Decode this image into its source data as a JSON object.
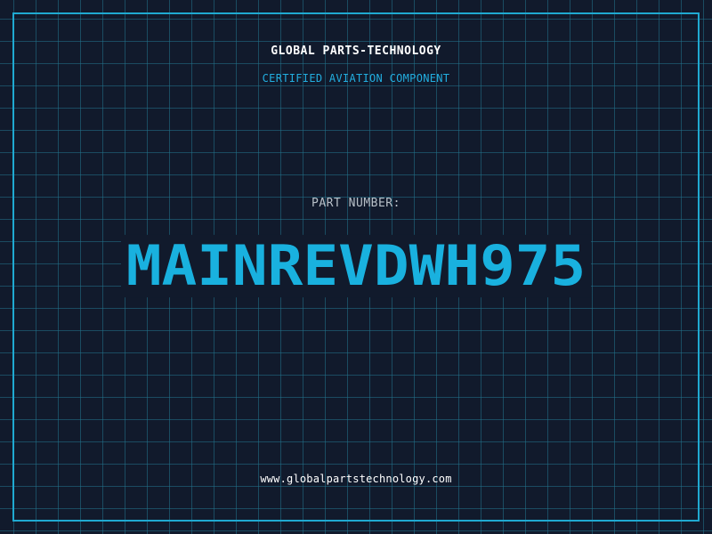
{
  "company": {
    "name": "GLOBAL PARTS-TECHNOLOGY",
    "tagline": "CERTIFIED AVIATION COMPONENT"
  },
  "part": {
    "label": "PART NUMBER:",
    "number": "MAINREVDWH975"
  },
  "footer": {
    "website": "www.globalpartstechnology.com"
  },
  "colors": {
    "background": "#111a2c",
    "grid": "#22738c",
    "frame": "#1fa9d1",
    "accent": "#19b1df",
    "text": "#ffffff",
    "muted": "#b8c0c8"
  }
}
